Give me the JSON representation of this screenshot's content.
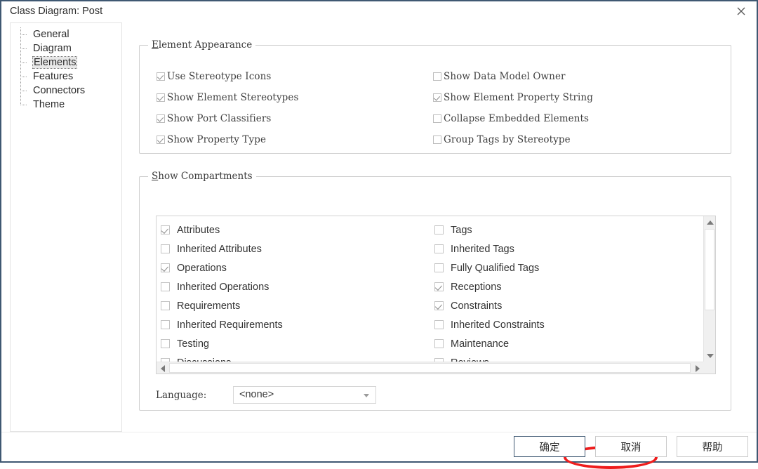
{
  "window": {
    "title": "Class Diagram: Post",
    "close_icon": "close-icon"
  },
  "sidebar": {
    "items": [
      {
        "label": "General",
        "selected": false
      },
      {
        "label": "Diagram",
        "selected": false
      },
      {
        "label": "Elements",
        "selected": true
      },
      {
        "label": "Features",
        "selected": false
      },
      {
        "label": "Connectors",
        "selected": false
      },
      {
        "label": "Theme",
        "selected": false
      }
    ]
  },
  "element_appearance": {
    "title_prefix": "E",
    "title_rest": "lement Appearance",
    "left_column": [
      {
        "label": "Use Stereotype Icons",
        "checked": true
      },
      {
        "label": "Show Element Stereotypes",
        "checked": true
      },
      {
        "label": "Show Port Classifiers",
        "checked": true
      },
      {
        "label": "Show Property Type",
        "checked": true
      }
    ],
    "right_column": [
      {
        "label": "Show Data Model Owner",
        "checked": false
      },
      {
        "label": "Show Element Property String",
        "checked": true
      },
      {
        "label": "Collapse Embedded Elements",
        "checked": false
      },
      {
        "label": "Group Tags by Stereotype",
        "checked": false
      }
    ]
  },
  "show_compartments": {
    "title_prefix": "S",
    "title_rest": "how Compartments",
    "left_column": [
      {
        "label": "Attributes",
        "checked": true
      },
      {
        "label": "Inherited Attributes",
        "checked": false
      },
      {
        "label": "Operations",
        "checked": true
      },
      {
        "label": "Inherited Operations",
        "checked": false
      },
      {
        "label": "Requirements",
        "checked": false
      },
      {
        "label": "Inherited Requirements",
        "checked": false
      },
      {
        "label": "Testing",
        "checked": false
      },
      {
        "label": "Discussions",
        "checked": false
      }
    ],
    "right_column": [
      {
        "label": "Tags",
        "checked": false
      },
      {
        "label": "Inherited Tags",
        "checked": false
      },
      {
        "label": "Fully Qualified Tags",
        "checked": false
      },
      {
        "label": "Receptions",
        "checked": true
      },
      {
        "label": "Constraints",
        "checked": true
      },
      {
        "label": "Inherited Constraints",
        "checked": false
      },
      {
        "label": "Maintenance",
        "checked": false
      },
      {
        "label": "Reviews",
        "checked": false
      }
    ],
    "highlighted_item": "Constraints",
    "highlight_color": "#ee1c1c"
  },
  "language": {
    "label_prefix": "Lan",
    "label_accel": "g",
    "label_suffix": "uage:",
    "value": "<none>",
    "dropdown_icon": "chevron-down-icon"
  },
  "scrollbars": {
    "vertical": {
      "up_icon": "arrow-up-icon",
      "down_icon": "arrow-down-icon"
    },
    "horizontal": {
      "left_icon": "arrow-left-icon",
      "right_icon": "arrow-right-icon"
    }
  },
  "buttons": [
    {
      "label": "确定",
      "default": true
    },
    {
      "label": "取消",
      "default": false
    },
    {
      "label": "帮助",
      "default": false
    }
  ]
}
